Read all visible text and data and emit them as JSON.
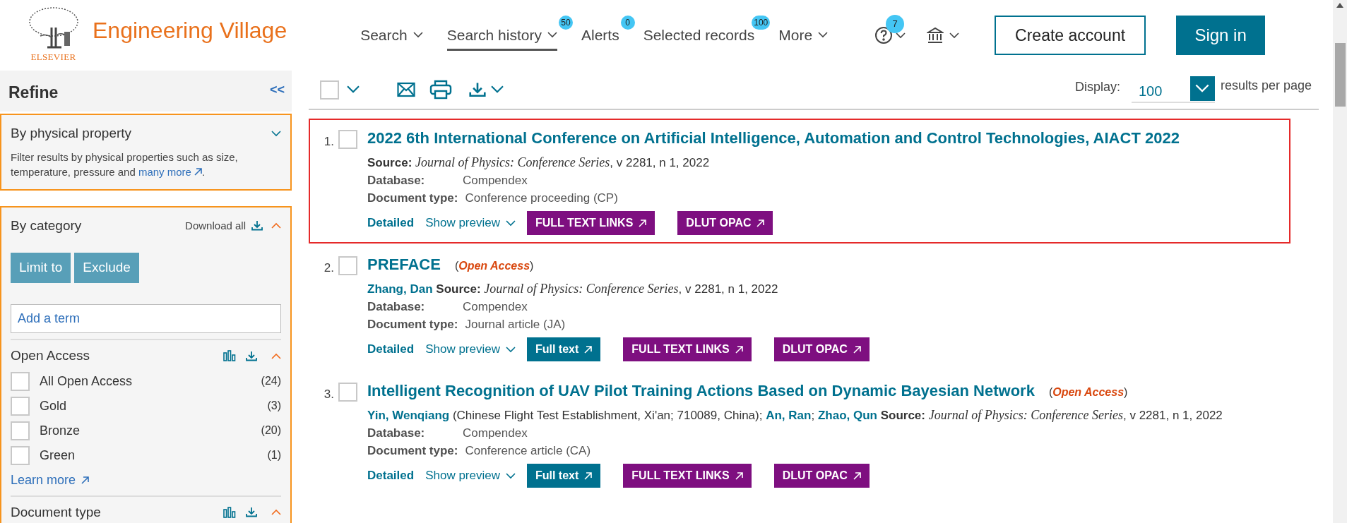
{
  "logo": {
    "publisher": "ELSEVIER",
    "product": "Engineering Village"
  },
  "nav": [
    {
      "label": "Search",
      "dropdown": true,
      "selected": false
    },
    {
      "label": "Search history",
      "dropdown": true,
      "selected": true,
      "badge": "50"
    },
    {
      "label": "Alerts",
      "dropdown": false,
      "selected": false,
      "badge": "0"
    },
    {
      "label": "Selected records",
      "dropdown": false,
      "selected": false,
      "badge": "100"
    },
    {
      "label": "More",
      "dropdown": true,
      "selected": false
    }
  ],
  "help_badge": "7",
  "account_buttons": {
    "create": "Create account",
    "sign_in": "Sign in"
  },
  "toolbar": {
    "select_all": {
      "checked": false
    },
    "display_label": "Display:",
    "display_value": "100",
    "display_suffix": "results per page"
  },
  "refine": {
    "title": "Refine",
    "collapse": "<<",
    "physical": {
      "title": "By physical property",
      "expanded": false,
      "text": "Filter results by physical properties such as size, temperature, pressure and",
      "link": "many more",
      "after_link": "."
    },
    "category": {
      "title": "By category",
      "expanded": true,
      "download": "Download all",
      "limit": "Limit to",
      "exclude": "Exclude",
      "placeholder": "Add a term",
      "facets": [
        {
          "title": "Open Access",
          "expanded": true,
          "items": [
            {
              "label": "All Open Access",
              "count": "(24)",
              "checked": false
            },
            {
              "label": "Gold",
              "count": "(3)",
              "checked": false
            },
            {
              "label": "Bronze",
              "count": "(20)",
              "checked": false
            },
            {
              "label": "Green",
              "count": "(1)",
              "checked": false
            }
          ],
          "more": "Learn more"
        },
        {
          "title": "Document type",
          "expanded": true
        }
      ]
    }
  },
  "results": [
    {
      "number": "1.",
      "checked": false,
      "highlighted": true,
      "title": "2022 6th International Conference on Artificial Intelligence, Automation and Control Technologies, AIACT 2022",
      "byline": [
        {
          "kind": "label",
          "text": "Source:"
        },
        {
          "kind": "source",
          "text": "Journal of Physics: Conference Series"
        },
        {
          "kind": "text",
          "text": ", v 2281, n 1, 2022"
        }
      ],
      "fields": [
        {
          "label": "Database:",
          "value": "Compendex"
        },
        {
          "label": "Document type:",
          "value": "Conference proceeding (CP)"
        }
      ],
      "detailed": "Detailed",
      "preview": "Show preview",
      "links": [
        {
          "kind": "links",
          "label": "FULL TEXT LINKS"
        },
        {
          "kind": "opac",
          "label": "DLUT OPAC"
        }
      ]
    },
    {
      "number": "2.",
      "checked": false,
      "highlighted": false,
      "title": "PREFACE",
      "open_access": "(*Open Access*)",
      "byline": [
        {
          "kind": "author",
          "text": "Zhang, Dan"
        },
        {
          "kind": "label",
          "text": "Source:"
        },
        {
          "kind": "source",
          "text": "Journal of Physics: Conference Series"
        },
        {
          "kind": "text",
          "text": ", v 2281, n 1, 2022"
        }
      ],
      "fields": [
        {
          "label": "Database:",
          "value": "Compendex"
        },
        {
          "label": "Document type:",
          "value": "Journal article (JA)"
        }
      ],
      "detailed": "Detailed",
      "preview": "Show preview",
      "links": [
        {
          "kind": "fulltext",
          "label": "Full text"
        },
        {
          "kind": "links",
          "label": "FULL TEXT LINKS"
        },
        {
          "kind": "opac",
          "label": "DLUT OPAC"
        }
      ]
    },
    {
      "number": "3.",
      "checked": false,
      "highlighted": false,
      "title": "Intelligent Recognition of UAV Pilot Training Actions Based on Dynamic Bayesian Network",
      "open_access": "(*Open Access*)",
      "byline": [
        {
          "kind": "author",
          "text": "Yin, Wenqiang"
        },
        {
          "kind": "text",
          "text": "(Chinese Flight Test Establishment, Xi'an; 710089, China);"
        },
        {
          "kind": "author",
          "text": "An, Ran"
        },
        {
          "kind": "text",
          "text": ";"
        },
        {
          "kind": "author",
          "text": "Zhao, Qun"
        },
        {
          "kind": "label",
          "text": "Source:"
        },
        {
          "kind": "source",
          "text": "Journal of Physics: Conference Series"
        },
        {
          "kind": "text",
          "text": ", v 2281, n 1, 2022"
        }
      ],
      "fields": [
        {
          "label": "Database:",
          "value": "Compendex"
        },
        {
          "label": "Document type:",
          "value": "Conference article (CA)"
        }
      ],
      "detailed": "Detailed",
      "preview": "Show preview",
      "links": [
        {
          "kind": "fulltext",
          "label": "Full text"
        },
        {
          "kind": "links",
          "label": "FULL TEXT LINKS"
        },
        {
          "kind": "opac",
          "label": "DLUT OPAC"
        }
      ]
    }
  ]
}
